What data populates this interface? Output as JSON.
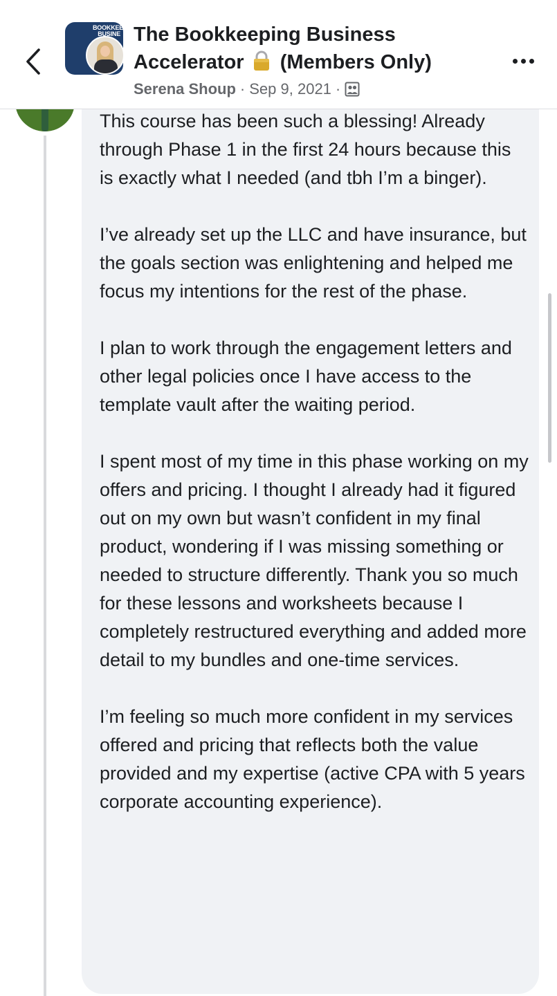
{
  "header": {
    "group_name_line1": "The Bookkeeping Business",
    "group_name_line2": "Accelerator",
    "group_name_suffix": "(Members Only)",
    "avatar_text": "BOOKKEE BUSINE",
    "author": "Serena Shoup",
    "separator": "·",
    "date": "Sep 9, 2021",
    "lock_icon": "lock-icon",
    "privacy_icon": "members-group-icon",
    "back_icon": "chevron-left-icon",
    "more_icon": "more-dots-icon"
  },
  "comment": {
    "paragraphs": [
      "This course has been such a blessing! Already through Phase 1  in the first 24 hours because this is exactly what I needed (and tbh I’m a binger).",
      "I’ve already set up the LLC and have insurance, but the goals section was enlightening and helped me focus my intentions for the rest of the phase.",
      "I plan to work through the engagement letters and other legal policies once I have access to the template vault after the waiting period.",
      "I spent most of my time in this phase working on my offers and pricing. I thought I already had it figured out on my own but wasn’t confident in my final product, wondering if I was missing something or needed to structure differently. Thank you so much for these lessons and worksheets because I completely restructured everything and added more detail to my bundles and one-time services.",
      "I’m feeling so much more confident in my services offered and pricing that reflects both the value provided and my expertise (active CPA with 5 years corporate accounting experience)."
    ]
  },
  "colors": {
    "bubble": "#f0f2f5",
    "text": "#1c1e21",
    "meta": "#65676b",
    "thread_line": "#d9dadd"
  }
}
